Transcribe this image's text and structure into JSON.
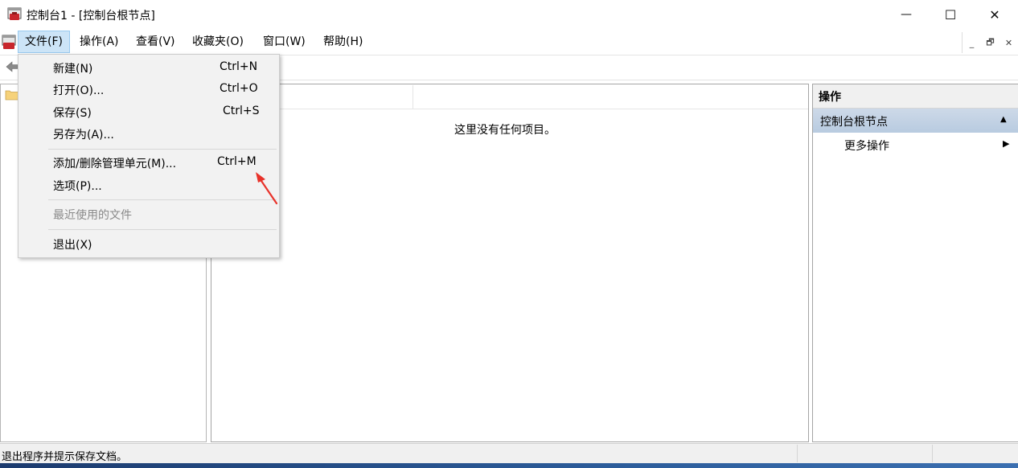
{
  "window": {
    "title": "控制台1 - [控制台根节点]",
    "minimize_glyph": "—",
    "maximize_glyph": "☐",
    "close_glyph": "✕"
  },
  "menubar": {
    "items": [
      {
        "label": "文件(F)"
      },
      {
        "label": "操作(A)"
      },
      {
        "label": "查看(V)"
      },
      {
        "label": "收藏夹(O)"
      },
      {
        "label": "窗口(W)"
      },
      {
        "label": "帮助(H)"
      }
    ],
    "mdi": {
      "minimize": "_",
      "restore": "🗗",
      "close": "✕"
    }
  },
  "file_menu": {
    "items": [
      {
        "label": "新建(N)",
        "shortcut": "Ctrl+N"
      },
      {
        "label": "打开(O)...",
        "shortcut": "Ctrl+O"
      },
      {
        "label": "保存(S)",
        "shortcut": "Ctrl+S"
      },
      {
        "label": "另存为(A)...",
        "shortcut": ""
      },
      {
        "label": "添加/删除管理单元(M)...",
        "shortcut": "Ctrl+M"
      },
      {
        "label": "选项(P)...",
        "shortcut": ""
      },
      {
        "label": "最近使用的文件",
        "shortcut": ""
      },
      {
        "label": "退出(X)",
        "shortcut": ""
      }
    ]
  },
  "center": {
    "empty_message": "这里没有任何项目。"
  },
  "actions": {
    "title": "操作",
    "group_label": "控制台根节点",
    "group_arrow": "▲",
    "more_label": "更多操作",
    "more_arrow": "▶"
  },
  "statusbar": {
    "text": "退出程序并提示保存文档。"
  },
  "colors": {
    "menu_highlight": "#cce4f7",
    "actions_group_bg": "#bfd0e4",
    "annotation_arrow": "#e8322a"
  }
}
